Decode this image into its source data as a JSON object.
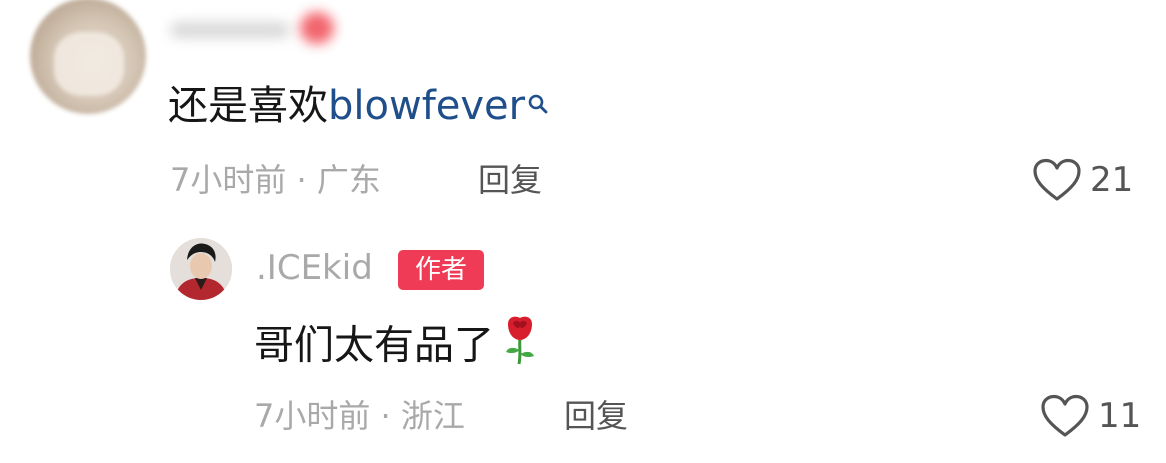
{
  "comment": {
    "text": "还是喜欢",
    "link_text": "blowfever",
    "meta": "7小时前 · 广东",
    "reply_label": "回复",
    "likes": "21"
  },
  "reply": {
    "username": ".ICEkid",
    "badge": "作者",
    "text": "哥们太有品了",
    "meta": "7小时前 · 浙江",
    "reply_label": "回复",
    "likes": "11"
  },
  "colors": {
    "link": "#1f4f8b",
    "badge": "#ef3b55",
    "meta": "#a9a9a9"
  },
  "icons": {
    "search_suggest": "search-icon",
    "like": "heart-outline-icon",
    "emoji": "rose-emoji-icon"
  }
}
